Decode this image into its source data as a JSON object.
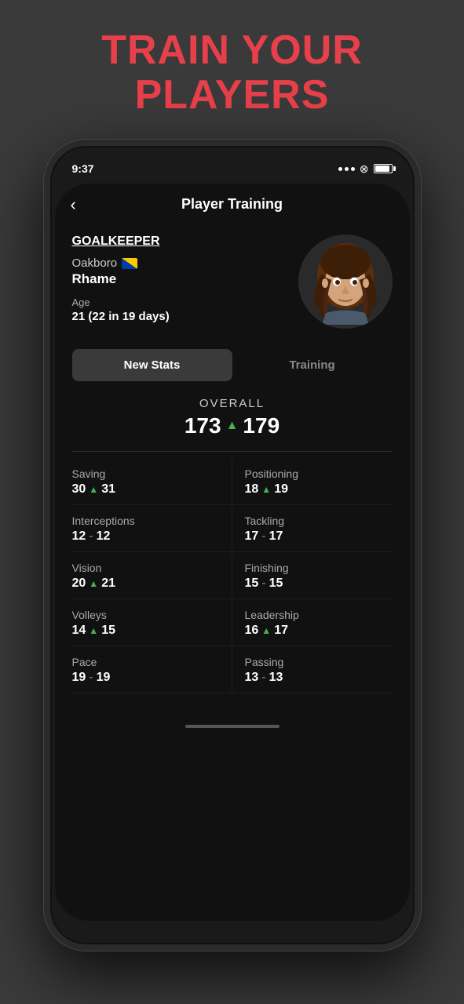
{
  "hero": {
    "title_line1": "TRAIN YOUR",
    "title_line2": "PLAYERS"
  },
  "status_bar": {
    "time": "9:37",
    "battery": "full"
  },
  "nav": {
    "back_label": "‹",
    "title": "Player Training"
  },
  "player": {
    "position": "GOALKEEPER",
    "team": "Oakboro",
    "name": "Rhame",
    "age_label": "Age",
    "age_value": "21 (22 in 19 days)"
  },
  "tabs": {
    "tab1_label": "New Stats",
    "tab2_label": "Training",
    "active": "tab1"
  },
  "overall": {
    "label": "OVERALL",
    "old_value": "173",
    "new_value": "179"
  },
  "stats": [
    {
      "label": "Saving",
      "old": "30",
      "new": "31",
      "changed": true
    },
    {
      "label": "Positioning",
      "old": "18",
      "new": "19",
      "changed": true
    },
    {
      "label": "Interceptions",
      "old": "12",
      "new": "12",
      "changed": false
    },
    {
      "label": "Tackling",
      "old": "17",
      "new": "17",
      "changed": false
    },
    {
      "label": "Vision",
      "old": "20",
      "new": "21",
      "changed": true
    },
    {
      "label": "Finishing",
      "old": "15",
      "new": "15",
      "changed": false
    },
    {
      "label": "Volleys",
      "old": "14",
      "new": "15",
      "changed": true
    },
    {
      "label": "Leadership",
      "old": "16",
      "new": "17",
      "changed": true
    },
    {
      "label": "Pace",
      "old": "19",
      "new": "19",
      "changed": false
    },
    {
      "label": "Passing",
      "old": "13",
      "new": "13",
      "changed": false
    }
  ]
}
